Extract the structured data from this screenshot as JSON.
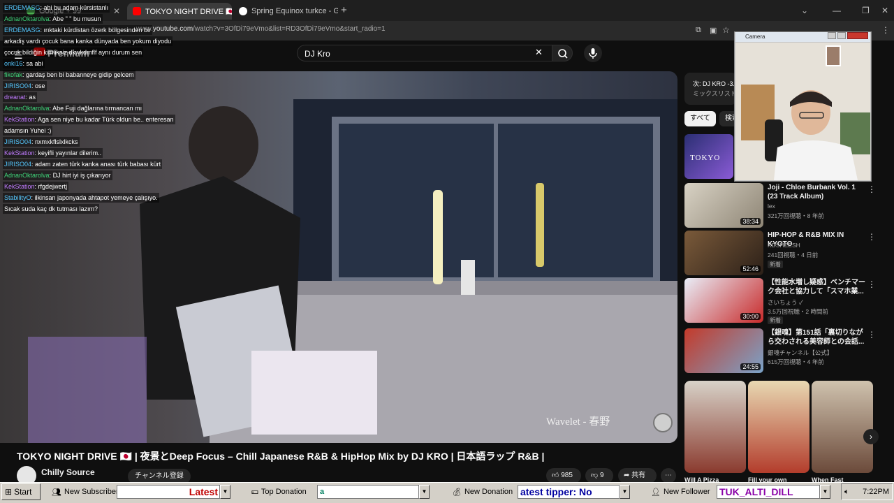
{
  "browser": {
    "tabs": [
      {
        "label": "Google + 99",
        "active": false
      },
      {
        "label": "TOKYO NIGHT DRIVE 🇯🇵 | 夜景と",
        "active": true
      },
      {
        "label": "Spring Equinox turkce - Google",
        "active": false
      }
    ],
    "url_prefix": "www.youtube.com",
    "url_rest": "/watch?v=3OfDi79eVmo&list=RD3OfDi79eVmo&start_radio=1"
  },
  "youtube": {
    "logo_label": "Premium",
    "search_value": "DJ Kro",
    "video": {
      "title": "TOKYO NIGHT DRIVE 🇯🇵 | 夜景とDeep Focus – Chill Japanese R&B & HipHop Mix by DJ KRO | 日本語ラップ R&B |",
      "overlay_text": "Wavelet - 春野",
      "channel": "Chilly Source",
      "subscribe_label": "チャンネル登録",
      "likes": "985",
      "dislikes": "9",
      "share_label": "共有"
    },
    "up_next": {
      "title": "次: DJ KRO -3...",
      "subtitle": "ミックスリスト"
    },
    "chips": [
      "すべて",
      "検索"
    ],
    "recommendations": [
      {
        "title": "Joji - Chloe Burbank Vol. 1 (23 Track Album)",
        "channel": "lex",
        "meta": "321万回視聴・8 年前",
        "duration": "38:34",
        "badge": ""
      },
      {
        "title": "HIP-HOP & R&B MIX IN KYOTO",
        "channel": "KDSHEESH",
        "meta": "241回視聴・4 日前",
        "duration": "52:46",
        "badge": "新着"
      },
      {
        "title": "【性能水増し疑惑】ベンチマーク会社と協力して「スマホ業...",
        "channel": "さいちょう ✓",
        "meta": "3.5万回視聴・2 時間前",
        "duration": "30:00",
        "badge": "新着"
      },
      {
        "title": "【銀魂】第151話「裏切りながら交わされる美容師との会話...",
        "channel": "銀魂チャンネル【公式】",
        "meta": "615万回視聴・4 年前",
        "duration": "24:55",
        "badge": ""
      }
    ],
    "shorts": [
      {
        "caption": "Will A Pizza"
      },
      {
        "caption": "Fill your own"
      },
      {
        "caption": "When Fast"
      }
    ]
  },
  "chat": [
    {
      "user": "ERDEMASG",
      "text": "abi bu adam kürsistanlı"
    },
    {
      "user": "AdnanOktarolva",
      "text": "Abe \" \" bu musun"
    },
    {
      "user": "ERDEMASG",
      "text": "ırıktaki kürdistan özerk bölgesinden bir"
    },
    {
      "user": "",
      "text": "arkadiş vardı çocuk bana kanka dünyada ben yokum diyodu"
    },
    {
      "user": "",
      "text": "çocuk bildiğin kimliksiz dkwkdmflf aynı durum sen"
    },
    {
      "user": "onki16",
      "text": "sa abi"
    },
    {
      "user": "fikofak",
      "text": "gardaş ben bi babanneye gidip gelcem"
    },
    {
      "user": "JIRISO04",
      "text": "ose"
    },
    {
      "user": "dreanat",
      "text": "as"
    },
    {
      "user": "AdnanOktarolva",
      "text": "Abe Fuji dağlarına tırmancan mı"
    },
    {
      "user": "KekStation",
      "text": "Aga sen niye bu kadar Türk oldun be.. enteresan"
    },
    {
      "user": "",
      "text": "adamsın Yuhei :)"
    },
    {
      "user": "JIRISO04",
      "text": "nxmxkflslxlkcks"
    },
    {
      "user": "KekStation",
      "text": "keyifli yayınlar dilerim.."
    },
    {
      "user": "JIRISO04",
      "text": "adam zaten türk kanka anası türk babası kürt"
    },
    {
      "user": "AdnanOktarolva",
      "text": "DJ hirt iyi iş çıkarıyor"
    },
    {
      "user": "KekStation",
      "text": "rfgdejwertj"
    },
    {
      "user": "StabilityO",
      "text": "ilkinsan japonyada ahtapot yemeye çalışıyo."
    },
    {
      "user": "",
      "text": "Sıcak suda kaç dk tutması lazım?"
    }
  ],
  "camera": {
    "title": "Camera"
  },
  "taskbar": {
    "start": "Start",
    "new_subscriber": "New Subscriber",
    "latest_field": "Latest",
    "top_donation": "Top Donation",
    "donation_field": "a",
    "new_donation": "New Donation",
    "tipper_field": "atest tipper: No",
    "new_follower": "New Follower",
    "follower_field": "TUK_ALTI_DILL",
    "clock": "7:22PM"
  },
  "colors": {
    "chat_user_red": "#ff5a5a",
    "chat_user_green": "#3fd67a",
    "chat_user_cyan": "#55c8ff",
    "chat_user_purple": "#c07bff",
    "yt_red": "#ff0000"
  }
}
